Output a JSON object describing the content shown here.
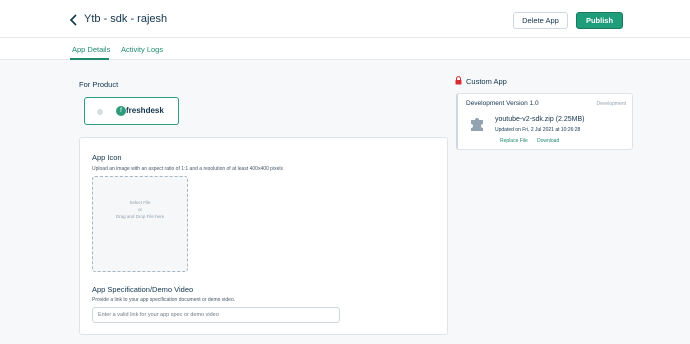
{
  "header": {
    "title": "Ytb - sdk - rajesh",
    "delete_label": "Delete App",
    "publish_label": "Publish"
  },
  "tabs": [
    {
      "label": "App Details",
      "active": true
    },
    {
      "label": "Activity Logs",
      "active": false
    }
  ],
  "product": {
    "section_label": "For Product",
    "name": "freshdesk"
  },
  "app_icon": {
    "label": "App Icon",
    "help": "Upload an image with an aspect ratio of 1:1 and a resolution of at least 400x400 pixels",
    "dropzone_line1": "Select File",
    "dropzone_line2": "or",
    "dropzone_line3": "Drag and Drop File here"
  },
  "spec": {
    "label": "App Specification/Demo Video",
    "help": "Provide a link to your app specification document or demo video.",
    "placeholder": "Enter a valid link for your app spec or demo video"
  },
  "custom_app": {
    "label": "Custom App",
    "version_title": "Development Version 1.0",
    "version_badge": "Development",
    "file_name": "youtube-v2-sdk.zip (2.25MB)",
    "updated": "Updated on Fri, 2 Jul 2021 at 10:26:28",
    "replace_label": "Replace File",
    "download_label": "Download"
  },
  "colors": {
    "accent": "#1f9c7a",
    "link": "#1f8a6d",
    "lock": "#d72d30"
  },
  "icons": {
    "back": "chevron-left-icon",
    "lock": "lock-icon",
    "file": "puzzle-icon",
    "product_logo": "freshdesk-logo-icon"
  }
}
